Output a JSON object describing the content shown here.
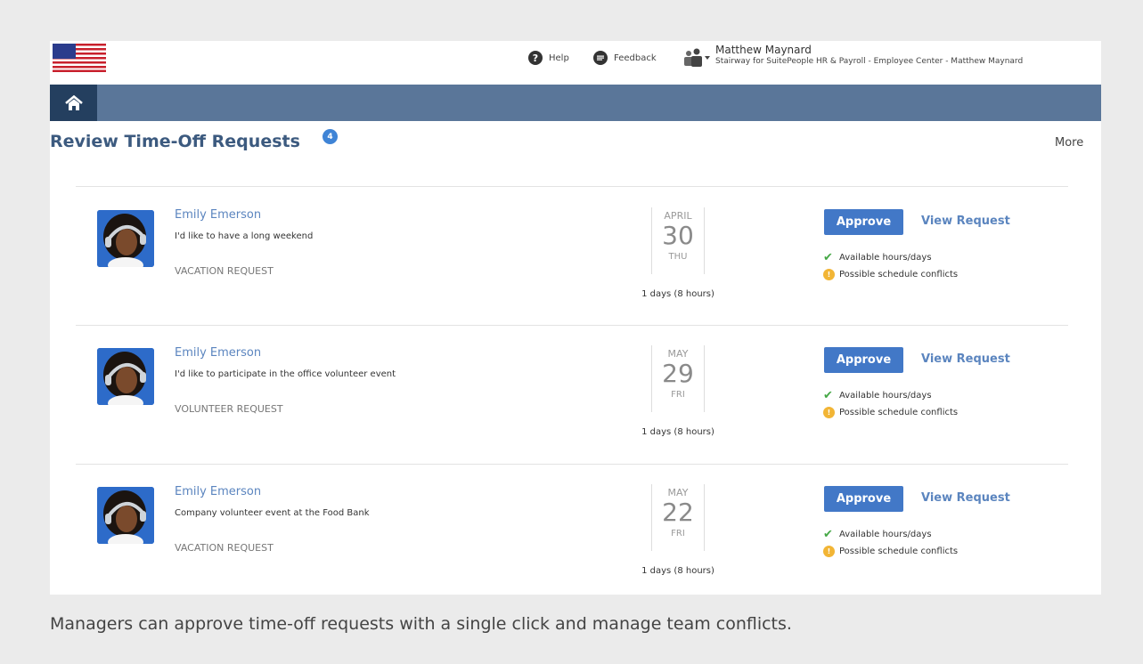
{
  "header": {
    "help_label": "Help",
    "feedback_label": "Feedback",
    "user_name": "Matthew Maynard",
    "user_context": "Stairway for SuitePeople HR & Payroll - Employee Center - Matthew Maynard"
  },
  "page": {
    "title": "Review Time-Off Requests",
    "badge_count": "4",
    "more_label": "More"
  },
  "requests": [
    {
      "name": "Emily Emerson",
      "description": "I'd like to have a long weekend",
      "type": "VACATION REQUEST",
      "month": "APRIL",
      "day": "30",
      "weekday": "THU",
      "duration": "1 days (8 hours)",
      "approve_label": "Approve",
      "view_label": "View Request",
      "available_label": "Available hours/days",
      "conflict_label": "Possible schedule conflicts"
    },
    {
      "name": "Emily Emerson",
      "description": "I'd like to participate in the office volunteer event",
      "type": "VOLUNTEER REQUEST",
      "month": "MAY",
      "day": "29",
      "weekday": "FRI",
      "duration": "1 days (8 hours)",
      "approve_label": "Approve",
      "view_label": "View Request",
      "available_label": "Available hours/days",
      "conflict_label": "Possible schedule conflicts"
    },
    {
      "name": "Emily Emerson",
      "description": "Company volunteer event at the Food Bank",
      "type": "VACATION REQUEST",
      "month": "MAY",
      "day": "22",
      "weekday": "FRI",
      "duration": "1 days (8 hours)",
      "approve_label": "Approve",
      "view_label": "View Request",
      "available_label": "Available hours/days",
      "conflict_label": "Possible schedule conflicts"
    }
  ],
  "caption": "Managers can approve time-off requests with a single click and manage team conflicts.",
  "colors": {
    "nav_bar": "#5a7699",
    "home_button": "#243f5f",
    "title": "#3c5a7f",
    "approve_button": "#4278c7",
    "link": "#5b85bf",
    "check": "#45a846",
    "warning": "#f2b535"
  },
  "icons": {
    "flag": "us-flag-icon",
    "help": "question-circle-icon",
    "feedback": "chat-bubble-icon",
    "user_switch": "people-icon",
    "home": "home-icon",
    "available": "checkmark-icon",
    "conflict": "warning-circle-icon"
  }
}
